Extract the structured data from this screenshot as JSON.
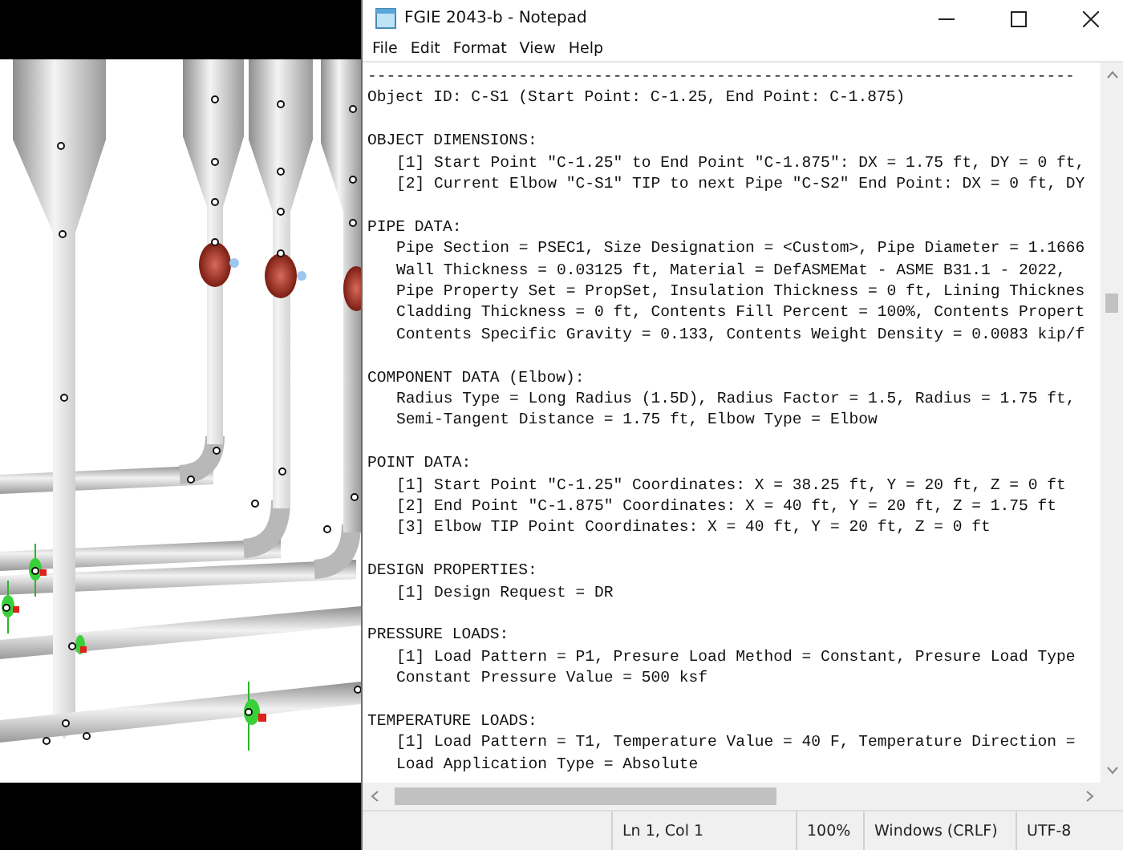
{
  "window": {
    "title": "FGIE 2043-b - Notepad"
  },
  "menu": [
    "File",
    "Edit",
    "Format",
    "View",
    "Help"
  ],
  "document": {
    "separator": "---------------------------------------------------------------------------",
    "header": "Object ID: C-S1 (Start Point: C-1.25, End Point: C-1.875)",
    "sections": [
      {
        "heading": "OBJECT DIMENSIONS:",
        "lines": [
          "[1] Start Point \"C-1.25\" to End Point \"C-1.875\": DX = 1.75 ft, DY = 0 ft,",
          "[2] Current Elbow \"C-S1\" TIP to next Pipe \"C-S2\" End Point: DX = 0 ft, DY"
        ]
      },
      {
        "heading": "PIPE DATA:",
        "lines": [
          "Pipe Section = PSEC1, Size Designation = <Custom>, Pipe Diameter = 1.1666",
          "Wall Thickness = 0.03125 ft, Material = DefASMEMat - ASME B31.1 - 2022,",
          "Pipe Property Set = PropSet, Insulation Thickness = 0 ft, Lining Thicknes",
          "Cladding Thickness = 0 ft, Contents Fill Percent = 100%, Contents Propert",
          "Contents Specific Gravity = 0.133, Contents Weight Density = 0.0083 kip/f"
        ]
      },
      {
        "heading": "COMPONENT DATA (Elbow):",
        "lines": [
          "Radius Type = Long Radius (1.5D), Radius Factor = 1.5, Radius = 1.75 ft,",
          "Semi-Tangent Distance = 1.75 ft, Elbow Type = Elbow"
        ]
      },
      {
        "heading": "POINT DATA:",
        "lines": [
          "[1] Start Point \"C-1.25\" Coordinates: X = 38.25 ft, Y = 20 ft, Z = 0 ft",
          "[2] End Point \"C-1.875\" Coordinates: X = 40 ft, Y = 20 ft, Z = 1.75 ft",
          "[3] Elbow TIP Point Coordinates: X = 40 ft, Y = 20 ft, Z = 0 ft"
        ]
      },
      {
        "heading": "DESIGN PROPERTIES:",
        "lines": [
          "[1] Design Request = DR"
        ]
      },
      {
        "heading": "PRESSURE LOADS:",
        "lines": [
          "[1] Load Pattern = P1, Presure Load Method = Constant, Presure Load Type",
          "Constant Pressure Value = 500 ksf"
        ]
      },
      {
        "heading": "TEMPERATURE LOADS:",
        "lines": [
          "[1] Load Pattern = T1, Temperature Value = 40 F, Temperature Direction =",
          "Load Application Type = Absolute"
        ]
      }
    ]
  },
  "status_bar": {
    "position": "Ln 1, Col 1",
    "zoom": "100%",
    "line_ending": "Windows (CRLF)",
    "encoding": "UTF-8"
  }
}
